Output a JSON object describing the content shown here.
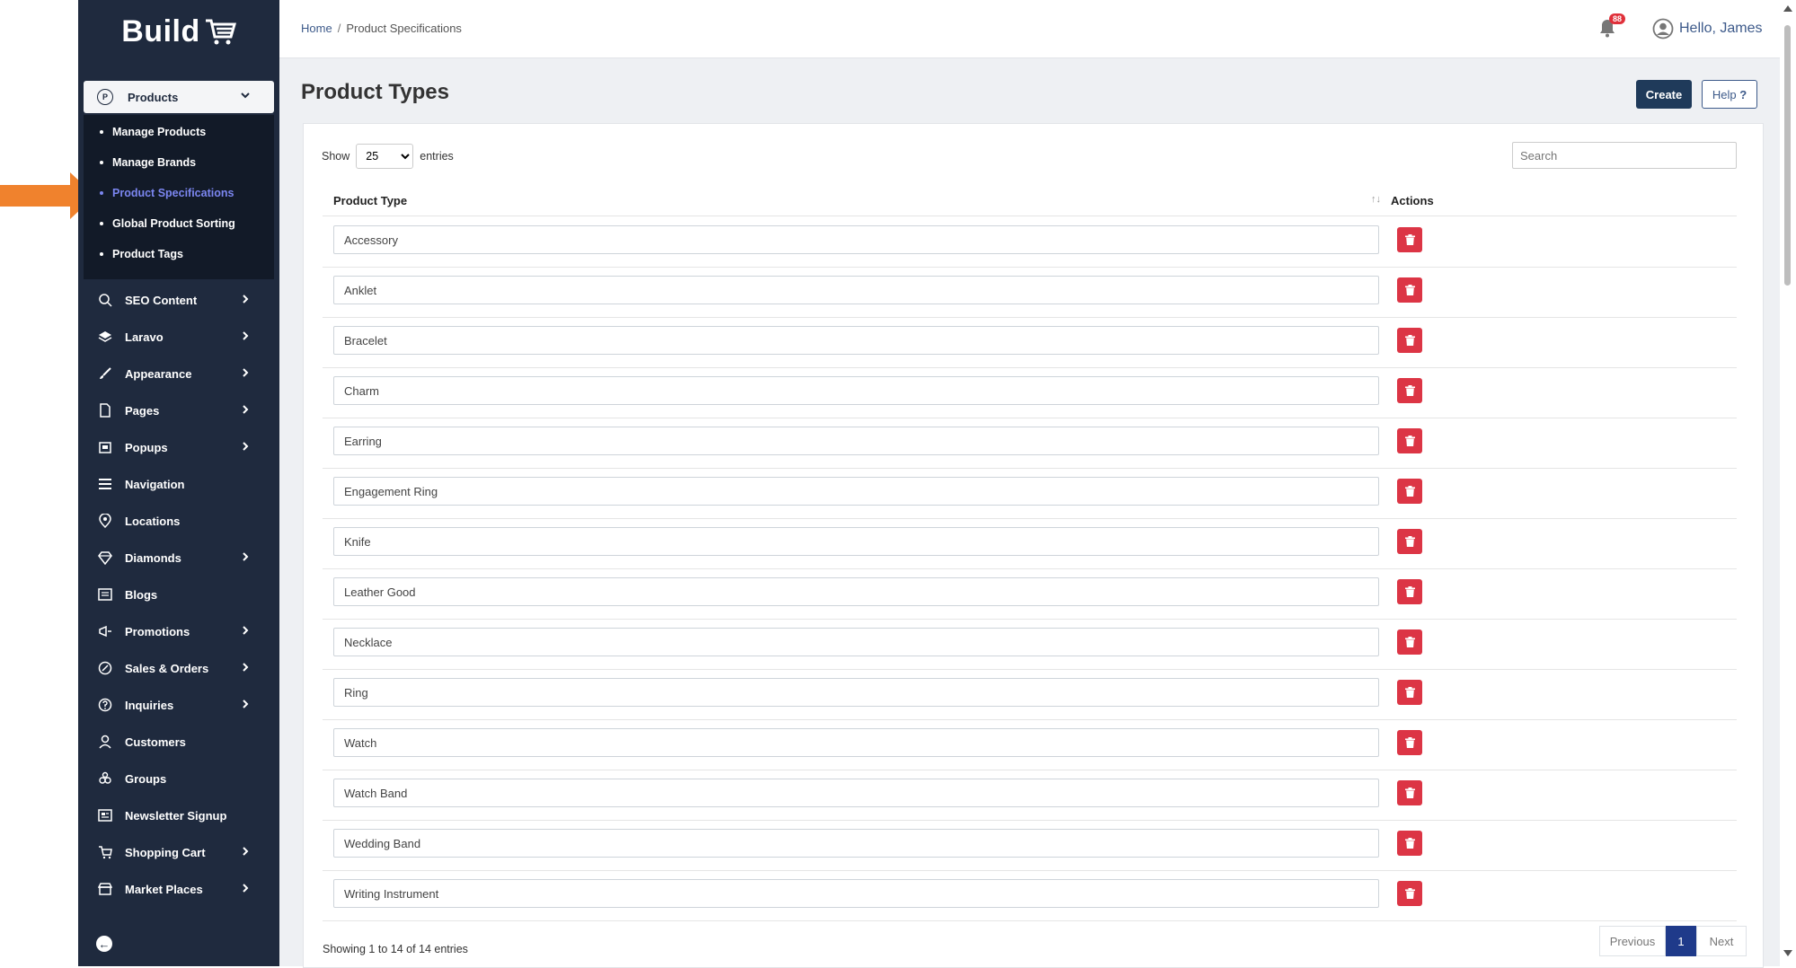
{
  "sidebar": {
    "logo_text": "Build",
    "products": {
      "label": "Products",
      "icon": "products-icon"
    },
    "submenu": [
      {
        "label": "Manage Products",
        "active": false
      },
      {
        "label": "Manage Brands",
        "active": false
      },
      {
        "label": "Product Specifications",
        "active": true
      },
      {
        "label": "Global Product Sorting",
        "active": false
      },
      {
        "label": "Product Tags",
        "active": false
      }
    ],
    "items": [
      {
        "label": "SEO Content",
        "icon": "seo-icon",
        "chevron": true
      },
      {
        "label": "Laravo",
        "icon": "layers-icon",
        "chevron": true
      },
      {
        "label": "Appearance",
        "icon": "brush-icon",
        "chevron": true
      },
      {
        "label": "Pages",
        "icon": "page-icon",
        "chevron": true
      },
      {
        "label": "Popups",
        "icon": "popup-icon",
        "chevron": true
      },
      {
        "label": "Navigation",
        "icon": "menu-icon",
        "chevron": false
      },
      {
        "label": "Locations",
        "icon": "location-pin-icon",
        "chevron": false
      },
      {
        "label": "Diamonds",
        "icon": "diamond-icon",
        "chevron": true
      },
      {
        "label": "Blogs",
        "icon": "blog-icon",
        "chevron": false
      },
      {
        "label": "Promotions",
        "icon": "megaphone-icon",
        "chevron": true
      },
      {
        "label": "Sales & Orders",
        "icon": "sales-icon",
        "chevron": true
      },
      {
        "label": "Inquiries",
        "icon": "question-icon",
        "chevron": true
      },
      {
        "label": "Customers",
        "icon": "user-icon",
        "chevron": false
      },
      {
        "label": "Groups",
        "icon": "group-icon",
        "chevron": false
      },
      {
        "label": "Newsletter Signup",
        "icon": "newsletter-icon",
        "chevron": false
      },
      {
        "label": "Shopping Cart",
        "icon": "cart-icon",
        "chevron": true
      },
      {
        "label": "Market Places",
        "icon": "store-icon",
        "chevron": true
      }
    ]
  },
  "topbar": {
    "breadcrumb_home": "Home",
    "breadcrumb_separator": "/",
    "breadcrumb_current": "Product Specifications",
    "notification_count": "88",
    "user_greeting": "Hello, James"
  },
  "main": {
    "title": "Product Types",
    "create_label": "Create",
    "help_label": "Help",
    "help_mark": "?"
  },
  "table": {
    "show_label": "Show",
    "entries_value": "25",
    "entries_label": "entries",
    "search_placeholder": "Search",
    "col_type": "Product Type",
    "col_actions": "Actions",
    "sort_glyph": "↑↓",
    "rows": [
      "Accessory",
      "Anklet",
      "Bracelet",
      "Charm",
      "Earring",
      "Engagement Ring",
      "Knife",
      "Leather Good",
      "Necklace",
      "Ring",
      "Watch",
      "Watch Band",
      "Wedding Band",
      "Writing Instrument"
    ],
    "info": "Showing 1 to 14 of 14 entries",
    "prev_label": "Previous",
    "page_label": "1",
    "next_label": "Next"
  },
  "colors": {
    "sidebar_bg": "#1f2a3e",
    "active_link": "#7b86f0",
    "delete_button": "#dc3545",
    "primary_button": "#1f3a5a",
    "arrow": "#f0822d"
  }
}
